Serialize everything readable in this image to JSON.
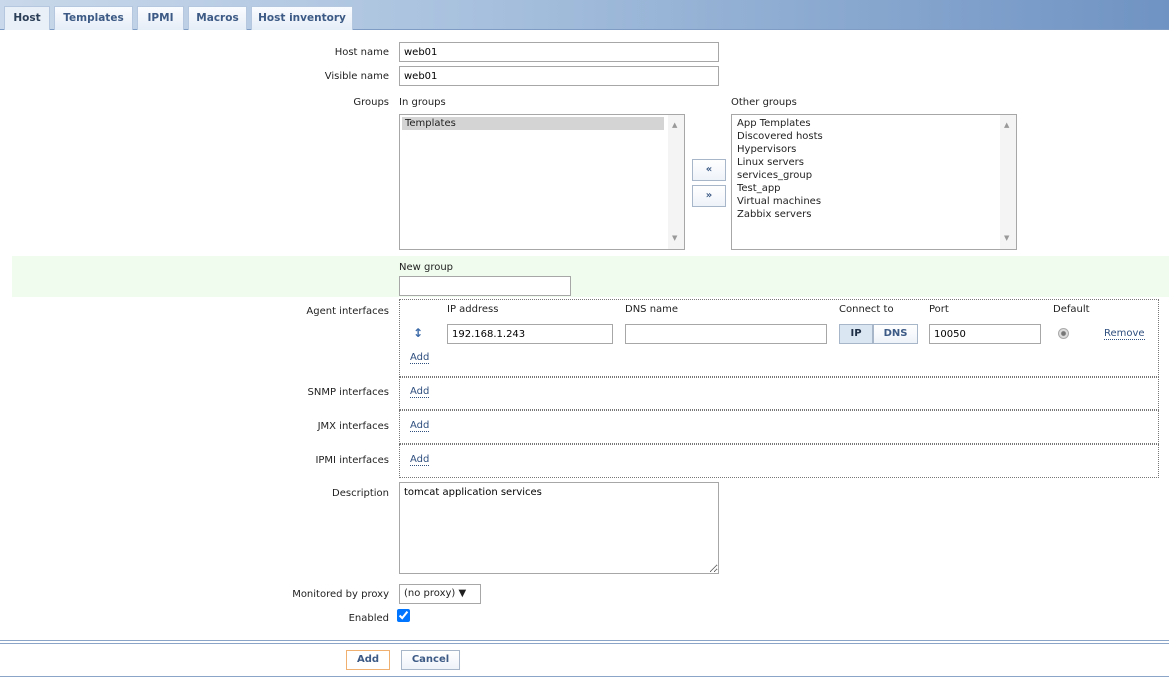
{
  "tabs": [
    {
      "label": "Host",
      "active": true
    },
    {
      "label": "Templates"
    },
    {
      "label": "IPMI"
    },
    {
      "label": "Macros"
    },
    {
      "label": "Host inventory"
    }
  ],
  "form": {
    "host_name_label": "Host name",
    "host_name": "web01",
    "visible_name_label": "Visible name",
    "visible_name": "web01",
    "groups_label": "Groups",
    "in_groups_label": "In groups",
    "in_groups": [
      "Templates"
    ],
    "other_groups_label": "Other groups",
    "other_groups": [
      "App Templates",
      "Discovered hosts",
      "Hypervisors",
      "Linux servers",
      "services_group",
      "Test_app",
      "Virtual machines",
      "Zabbix servers"
    ],
    "move_left": "«",
    "move_right": "»",
    "new_group_label": "New group",
    "new_group": "",
    "agent_interfaces_label": "Agent interfaces",
    "iface_headers": {
      "ip": "IP address",
      "dns": "DNS name",
      "connect": "Connect to",
      "port": "Port",
      "default": "Default"
    },
    "agent_iface": {
      "ip": "192.168.1.243",
      "dns": "",
      "connect_ip": "IP",
      "connect_dns": "DNS",
      "port": "10050",
      "remove": "Remove"
    },
    "add_label": "Add",
    "snmp_label": "SNMP interfaces",
    "jmx_label": "JMX interfaces",
    "ipmi_label": "IPMI interfaces",
    "description_label": "Description",
    "description": "tomcat application services",
    "proxy_label": "Monitored by proxy",
    "proxy": "(no proxy)",
    "enabled_label": "Enabled",
    "enabled": true
  },
  "actions": {
    "add": "Add",
    "cancel": "Cancel"
  },
  "colors": {
    "accent": "#3c5a85",
    "new_group_bg": "#f0fdee"
  }
}
